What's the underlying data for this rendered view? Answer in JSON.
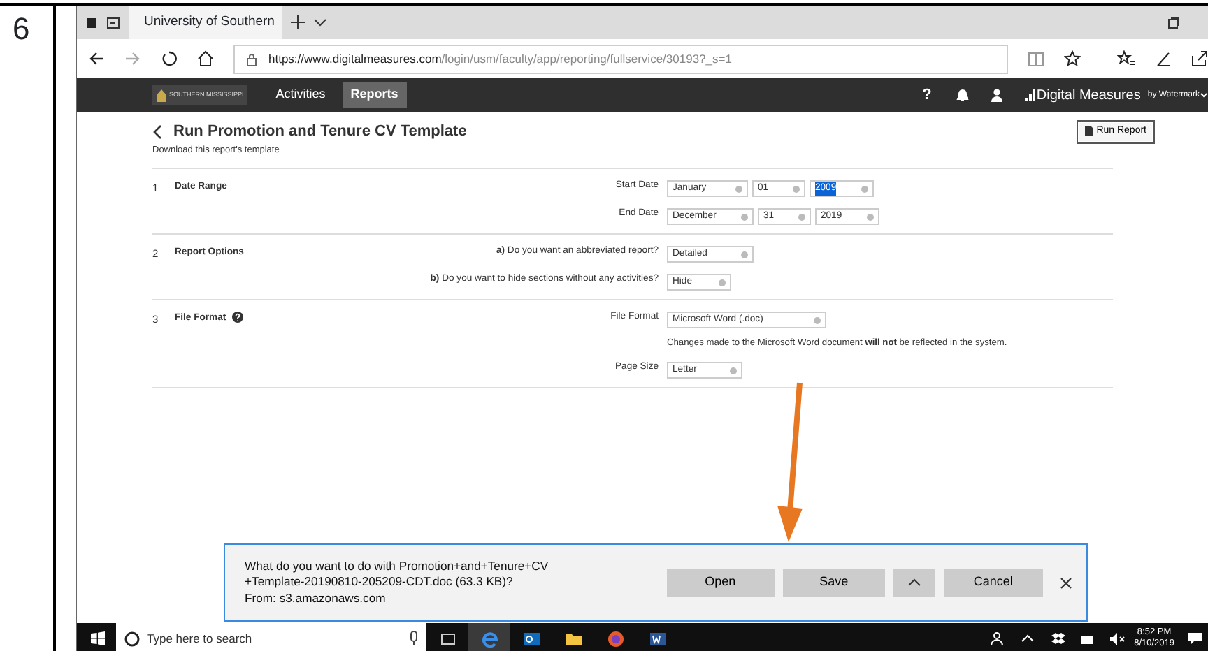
{
  "step_number": "6",
  "browser": {
    "tabs": [
      {
        "title": "University of Southern",
        "selected": true
      }
    ],
    "url_host": "https://www.digitalmeasures.com",
    "url_path": "/login/usm/faculty/app/reporting/fullservice/30193?_s=1"
  },
  "nav": {
    "logo_text": "SOUTHERN MISSISSIPPI",
    "items": [
      {
        "label": "Activities",
        "selected": false
      },
      {
        "label": "Reports",
        "selected": true
      }
    ],
    "help": "?",
    "brand": "Digital Measures",
    "brand_suffix": "by Watermark"
  },
  "page": {
    "title": "Run Promotion and Tenure CV Template",
    "subtitle": "Download this report's template",
    "run_button": "Run Report",
    "sections": [
      {
        "number": "1",
        "title": "Date Range",
        "has_help": false,
        "rows": [
          {
            "label": "Start Date",
            "fields": [
              {
                "value": "January",
                "selected": false
              },
              {
                "value": "01",
                "selected": false
              },
              {
                "value": "2009",
                "selected": true
              }
            ]
          },
          {
            "label": "End Date",
            "fields": [
              {
                "value": "December",
                "selected": false
              },
              {
                "value": "31",
                "selected": false
              },
              {
                "value": "2019",
                "selected": false
              }
            ]
          }
        ]
      },
      {
        "number": "2",
        "title": "Report Options",
        "has_help": false,
        "rows": [
          {
            "label": "**a)** Do you want an abbreviated report?",
            "fields": [
              {
                "value": "Detailed",
                "selected": false
              }
            ]
          },
          {
            "label": "**b)** Do you want to hide sections without any activities?",
            "fields": [
              {
                "value": "Hide",
                "selected": false
              }
            ]
          }
        ]
      },
      {
        "number": "3",
        "title": "File Format",
        "has_help": true,
        "rows": [
          {
            "label": "File Format",
            "fields": [
              {
                "value": "Microsoft Word (.doc)",
                "selected": false
              }
            ],
            "note": "Changes made to the Microsoft Word document **will not** be reflected in the system."
          },
          {
            "label": "Page Size",
            "fields": [
              {
                "value": "Letter",
                "selected": false
              }
            ]
          }
        ]
      }
    ]
  },
  "download_bar": {
    "message": "What do you want to do with Promotion+and+Tenure+CV +Template-20190810-205209-CDT.doc (63.3 KB)?",
    "source": "From: s3.amazonaws.com",
    "buttons": [
      "Open",
      "Save",
      "Cancel"
    ]
  },
  "taskbar": {
    "search_placeholder": "Type here to search",
    "time": "8:52 PM",
    "date": "8/10/2019"
  }
}
